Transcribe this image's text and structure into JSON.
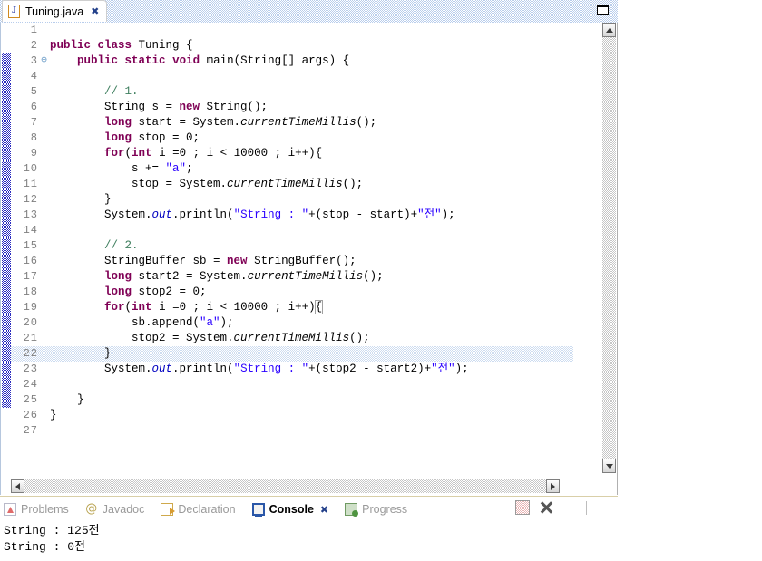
{
  "editor": {
    "tab": {
      "label": "Tuning.java",
      "icon": "java-file-icon",
      "close": "✖"
    },
    "maximize_label": "",
    "lines": [
      {
        "n": "1",
        "fold": "",
        "changed": false,
        "current": false,
        "html": ""
      },
      {
        "n": "2",
        "fold": "",
        "changed": false,
        "current": false,
        "html": "<span class=\"kw\">public</span> <span class=\"kw\">class</span> Tuning {"
      },
      {
        "n": "3",
        "fold": "⊖",
        "changed": true,
        "current": false,
        "html": "    <span class=\"kw\">public</span> <span class=\"kw\">static</span> <span class=\"kw\">void</span> main(String[] args) {"
      },
      {
        "n": "4",
        "fold": "",
        "changed": true,
        "current": false,
        "html": ""
      },
      {
        "n": "5",
        "fold": "",
        "changed": true,
        "current": false,
        "html": "        <span class=\"cmt\">// 1.</span>"
      },
      {
        "n": "6",
        "fold": "",
        "changed": true,
        "current": false,
        "html": "        String s = <span class=\"kw\">new</span> String();"
      },
      {
        "n": "7",
        "fold": "",
        "changed": true,
        "current": false,
        "html": "        <span class=\"kw\">long</span> start = System.<span class=\"stat\">currentTimeMillis</span>();"
      },
      {
        "n": "8",
        "fold": "",
        "changed": true,
        "current": false,
        "html": "        <span class=\"kw\">long</span> stop = 0;"
      },
      {
        "n": "9",
        "fold": "",
        "changed": true,
        "current": false,
        "html": "        <span class=\"kw\">for</span>(<span class=\"kw\">int</span> i =0 ; i &lt; 10000 ; i++){"
      },
      {
        "n": "10",
        "fold": "",
        "changed": true,
        "current": false,
        "html": "            s += <span class=\"str\">\"a\"</span>;"
      },
      {
        "n": "11",
        "fold": "",
        "changed": true,
        "current": false,
        "html": "            stop = System.<span class=\"stat\">currentTimeMillis</span>();"
      },
      {
        "n": "12",
        "fold": "",
        "changed": true,
        "current": false,
        "html": "        }"
      },
      {
        "n": "13",
        "fold": "",
        "changed": true,
        "current": false,
        "html": "        System.<span class=\"fld\">out</span>.println(<span class=\"str\">\"String : \"</span>+(stop - start)+<span class=\"str\">\"전\"</span>);"
      },
      {
        "n": "14",
        "fold": "",
        "changed": true,
        "current": false,
        "html": ""
      },
      {
        "n": "15",
        "fold": "",
        "changed": true,
        "current": false,
        "html": "        <span class=\"cmt\">// 2.</span>"
      },
      {
        "n": "16",
        "fold": "",
        "changed": true,
        "current": false,
        "html": "        StringBuffer sb = <span class=\"kw\">new</span> StringBuffer();"
      },
      {
        "n": "17",
        "fold": "",
        "changed": true,
        "current": false,
        "html": "        <span class=\"kw\">long</span> start2 = System.<span class=\"stat\">currentTimeMillis</span>();"
      },
      {
        "n": "18",
        "fold": "",
        "changed": true,
        "current": false,
        "html": "        <span class=\"kw\">long</span> stop2 = 0;"
      },
      {
        "n": "19",
        "fold": "",
        "changed": true,
        "current": false,
        "html": "        <span class=\"kw\">for</span>(<span class=\"kw\">int</span> i =0 ; i &lt; 10000 ; i++)<span class=\"bracketbox\">{</span>"
      },
      {
        "n": "20",
        "fold": "",
        "changed": true,
        "current": false,
        "html": "            sb.append(<span class=\"str\">\"a\"</span>);"
      },
      {
        "n": "21",
        "fold": "",
        "changed": true,
        "current": false,
        "html": "            stop2 = System.<span class=\"stat\">currentTimeMillis</span>();"
      },
      {
        "n": "22",
        "fold": "",
        "changed": true,
        "current": true,
        "html": "        }"
      },
      {
        "n": "23",
        "fold": "",
        "changed": true,
        "current": false,
        "html": "        System.<span class=\"fld\">out</span>.println(<span class=\"str\">\"String : \"</span>+(stop2 - start2)+<span class=\"str\">\"전\"</span>);"
      },
      {
        "n": "24",
        "fold": "",
        "changed": true,
        "current": false,
        "html": ""
      },
      {
        "n": "25",
        "fold": "",
        "changed": true,
        "current": false,
        "html": "    }"
      },
      {
        "n": "26",
        "fold": "",
        "changed": false,
        "current": false,
        "html": "}"
      },
      {
        "n": "27",
        "fold": "",
        "changed": false,
        "current": false,
        "html": ""
      }
    ]
  },
  "console_part": {
    "tabs": [
      {
        "label": "Problems",
        "icon": "problems-icon",
        "active": false,
        "closeable": false
      },
      {
        "label": "Javadoc",
        "icon": "javadoc-icon",
        "active": false,
        "closeable": false
      },
      {
        "label": "Declaration",
        "icon": "declaration-icon",
        "active": false,
        "closeable": false
      },
      {
        "label": "Console",
        "icon": "console-icon",
        "active": true,
        "closeable": true
      },
      {
        "label": "Progress",
        "icon": "progress-icon",
        "active": false,
        "closeable": false
      }
    ],
    "close_glyph": "✖",
    "toolbar": [
      {
        "name": "clear-console-button",
        "icon": "clear-icon"
      },
      {
        "name": "terminate-button",
        "icon": "terminate-icon"
      },
      {
        "name": "remove-all-terminated-button",
        "icon": "remove-all-icon"
      },
      {
        "name": "open-console-button",
        "icon": "new-console-icon"
      }
    ],
    "output_lines": [
      "String : 125전",
      "String : 0전"
    ]
  }
}
